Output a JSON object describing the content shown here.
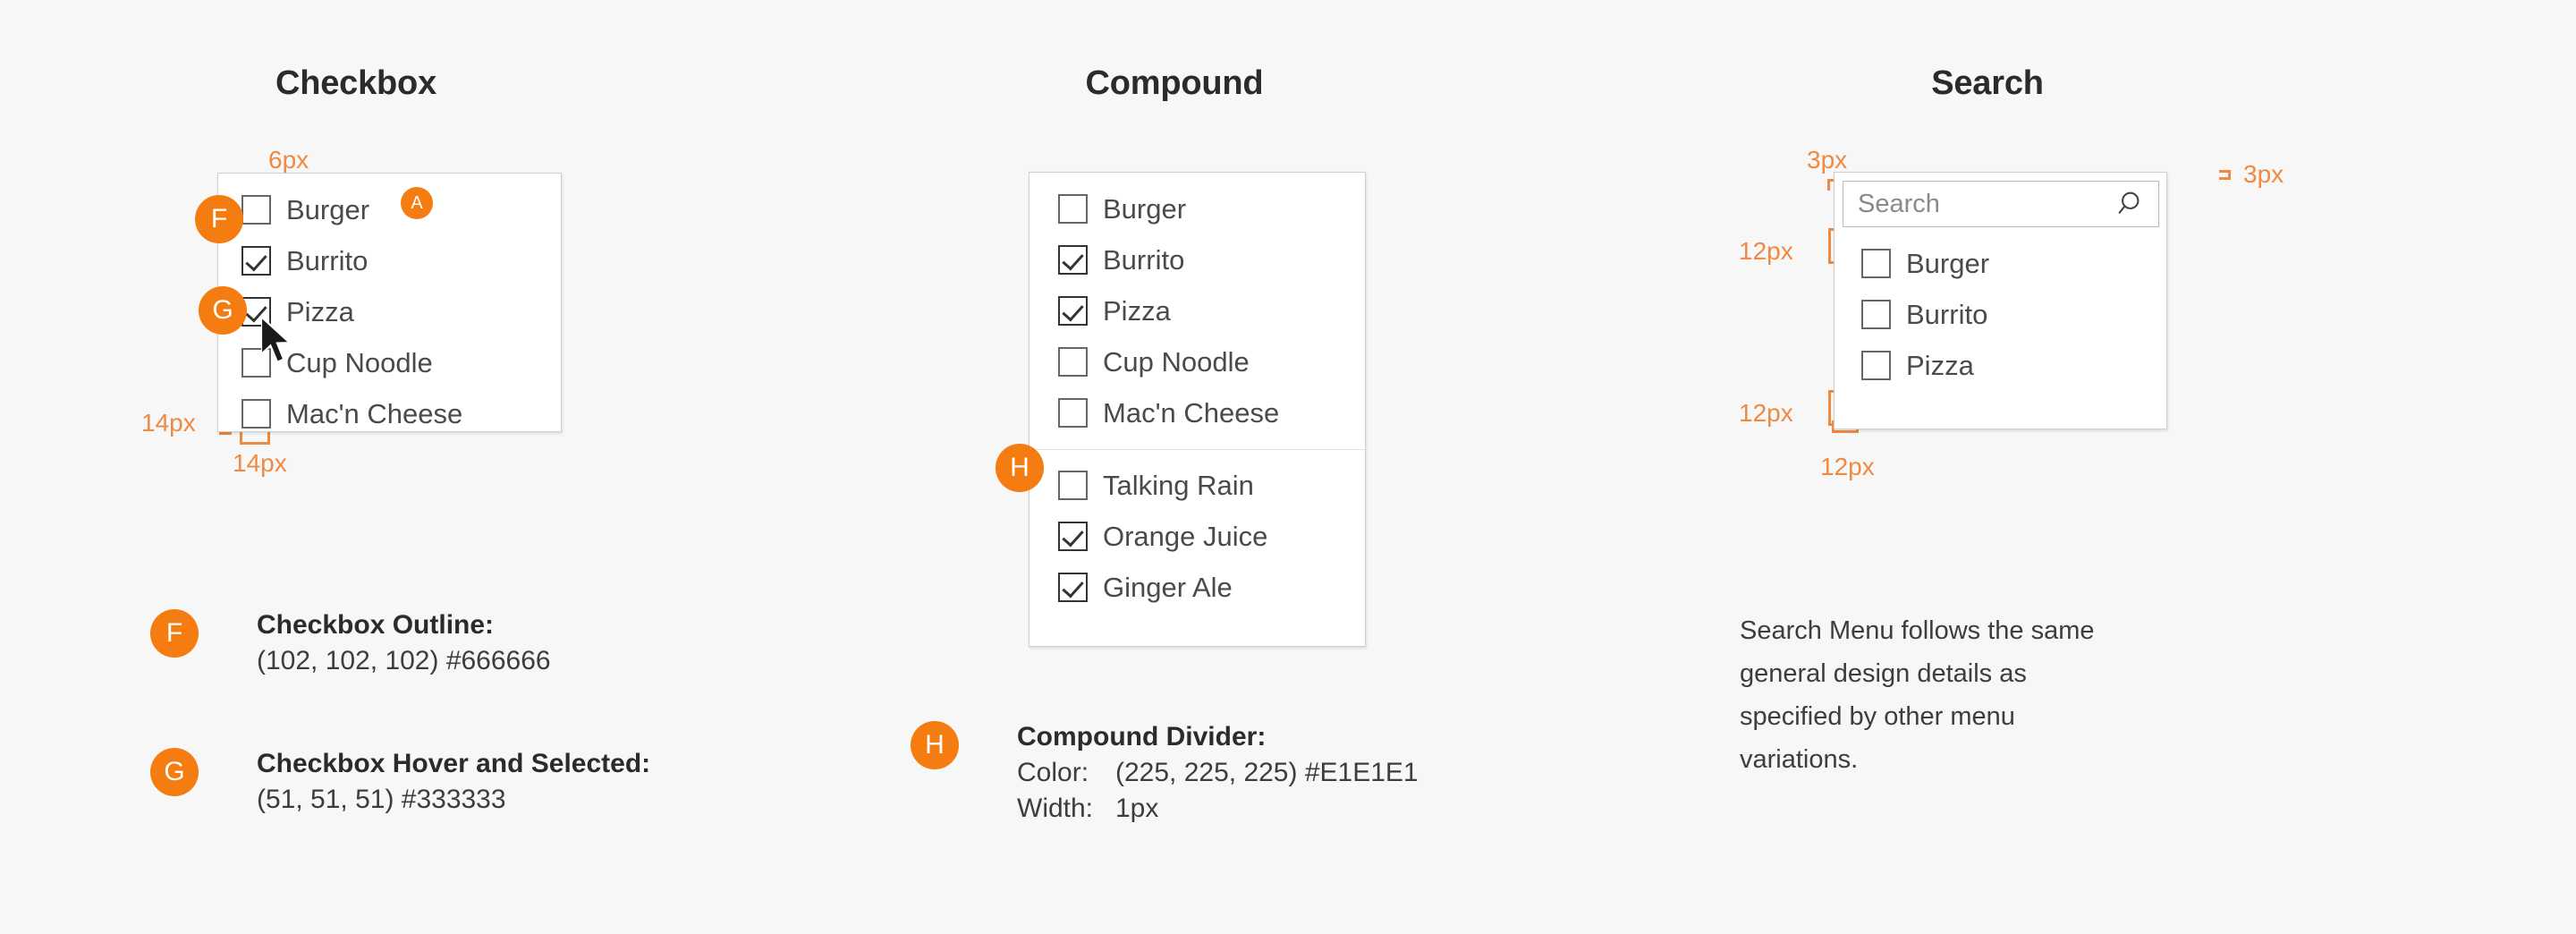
{
  "colors": {
    "accent": "#F57C10",
    "spec_marker": "#EE8A42",
    "checkbox_outline": "#666666",
    "checkbox_selected": "#333333",
    "divider": "#E1E1E1",
    "page_bg": "#F7F7F7",
    "panel_bg": "#FFFFFF"
  },
  "columns": {
    "checkbox": {
      "title": "Checkbox",
      "items": [
        {
          "label": "Burger",
          "checked": false
        },
        {
          "label": "Burrito",
          "checked": true
        },
        {
          "label": "Pizza",
          "checked": true
        },
        {
          "label": "Cup Noodle",
          "checked": false
        },
        {
          "label": "Mac'n Cheese",
          "checked": false
        }
      ],
      "specs": {
        "top_gap": "6px",
        "left_gap": "14px",
        "bottom_gap": "14px"
      },
      "badges": {
        "a": "A",
        "f": "F",
        "g": "G"
      }
    },
    "compound": {
      "title": "Compound",
      "group_one": [
        {
          "label": "Burger",
          "checked": false
        },
        {
          "label": "Burrito",
          "checked": true
        },
        {
          "label": "Pizza",
          "checked": true
        },
        {
          "label": "Cup Noodle",
          "checked": false
        },
        {
          "label": "Mac'n Cheese",
          "checked": false
        }
      ],
      "group_two": [
        {
          "label": "Talking Rain",
          "checked": false
        },
        {
          "label": "Orange Juice",
          "checked": true
        },
        {
          "label": "Ginger Ale",
          "checked": true
        }
      ],
      "badges": {
        "h": "H"
      }
    },
    "search": {
      "title": "Search",
      "search_placeholder": "Search",
      "search_value": "",
      "items": [
        {
          "label": "Burger",
          "checked": false
        },
        {
          "label": "Burrito",
          "checked": false
        },
        {
          "label": "Pizza",
          "checked": false
        }
      ],
      "specs": {
        "top_gap": "3px",
        "right_gap": "3px",
        "above_list": "12px",
        "below_list": "12px",
        "left_gap": "12px"
      },
      "note": "Search Menu follows the same general design details as specified by other menu variations."
    }
  },
  "legend": {
    "f": {
      "badge": "F",
      "title": "Checkbox Outline:",
      "value": "(102, 102, 102) #666666"
    },
    "g": {
      "badge": "G",
      "title": "Checkbox Hover and Selected:",
      "value": "(51, 51, 51) #333333"
    },
    "h": {
      "badge": "H",
      "title": "Compound Divider:",
      "color_label": "Color:",
      "color_value": "(225, 225, 225) #E1E1E1",
      "width_label": "Width:",
      "width_value": "1px"
    }
  }
}
